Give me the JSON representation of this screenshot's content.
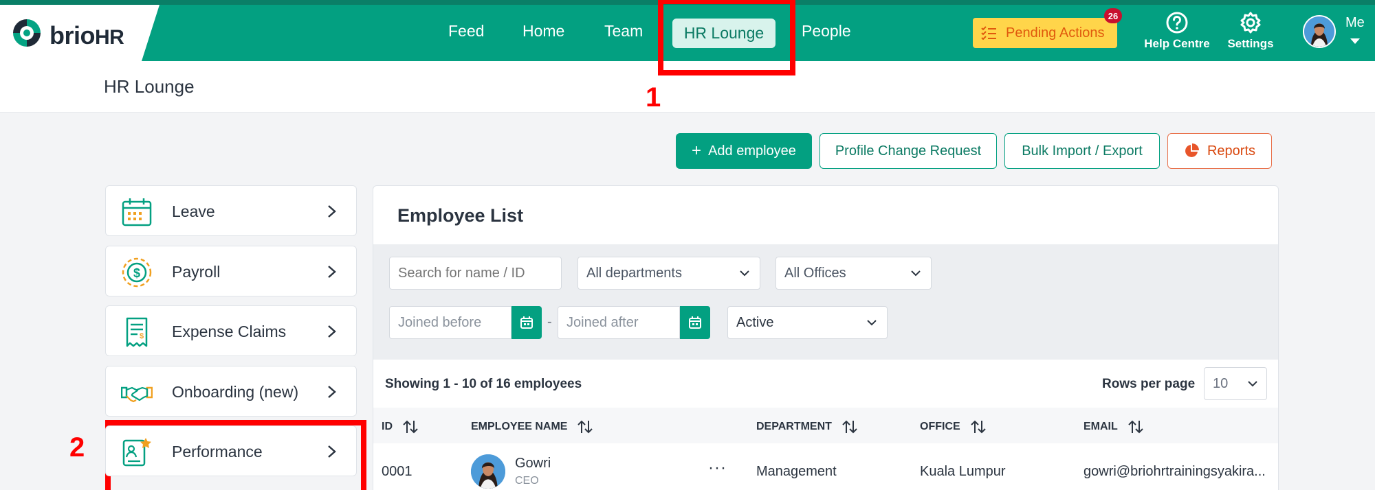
{
  "brand": {
    "name": "brio",
    "suffix": "HR"
  },
  "nav": {
    "items": [
      "Feed",
      "Home",
      "Team",
      "HR Lounge",
      "People"
    ],
    "active": "HR Lounge"
  },
  "topbar": {
    "pending_label": "Pending Actions",
    "pending_count": "26",
    "help_label": "Help Centre",
    "settings_label": "Settings",
    "me_label": "Me"
  },
  "page": {
    "title": "HR Lounge"
  },
  "annotations": {
    "one": "1",
    "two": "2"
  },
  "actions": {
    "add_employee": "Add employee",
    "profile_change": "Profile Change Request",
    "bulk_import": "Bulk Import / Export",
    "reports": "Reports"
  },
  "menu": {
    "items": [
      {
        "label": "Leave",
        "icon": "calendar-icon"
      },
      {
        "label": "Payroll",
        "icon": "dollar-coin-icon"
      },
      {
        "label": "Expense Claims",
        "icon": "receipt-icon"
      },
      {
        "label": "Onboarding (new)",
        "icon": "handshake-icon"
      },
      {
        "label": "Performance",
        "icon": "performance-badge-icon"
      }
    ]
  },
  "employee_list": {
    "title": "Employee List",
    "filters": {
      "search_placeholder": "Search for name / ID",
      "department": "All departments",
      "office": "All Offices",
      "joined_before_placeholder": "Joined before",
      "joined_after_placeholder": "Joined after",
      "separator": "-",
      "status": "Active"
    },
    "showing": "Showing 1 - 10 of 16 employees",
    "rows_per_page_label": "Rows per page",
    "rows_per_page": "10",
    "columns": [
      "ID",
      "EMPLOYEE NAME",
      "DEPARTMENT",
      "OFFICE",
      "EMAIL"
    ],
    "rows": [
      {
        "id": "0001",
        "name": "Gowri",
        "role": "CEO",
        "more": "···",
        "department": "Management",
        "office": "Kuala Lumpur",
        "email": "gowri@briohrtrainingsyakira..."
      }
    ]
  },
  "colors": {
    "brand_green": "#03a081",
    "pending_yellow": "#ffd54a",
    "annotation_red": "#ff0000",
    "reports_orange": "#d9480f"
  }
}
